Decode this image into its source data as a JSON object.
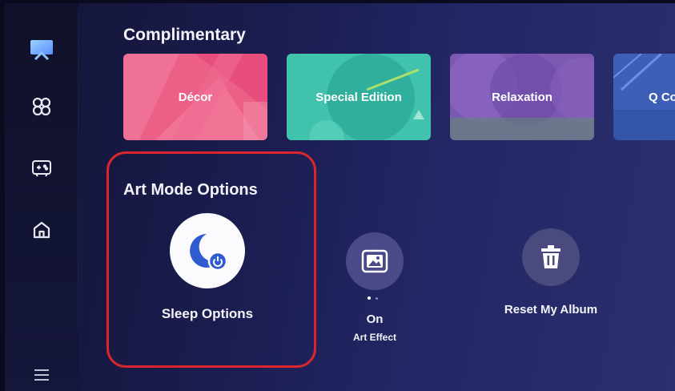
{
  "sidebar": {
    "items": [
      {
        "icon": "art-mode-icon",
        "active": true
      },
      {
        "icon": "ambient-icon"
      },
      {
        "icon": "game-controller-icon"
      },
      {
        "icon": "home-icon"
      }
    ],
    "menu_icon": "menu-icon"
  },
  "complimentary": {
    "title": "Complimentary",
    "tiles": [
      {
        "label": "Décor",
        "color": "#ec5f86"
      },
      {
        "label": "Special Edition",
        "color": "#41c2ad"
      },
      {
        "label": "Relaxation",
        "color": "#7b58b2"
      },
      {
        "label": "Q Co",
        "color": "#3d5fb8"
      }
    ]
  },
  "art_mode_options": {
    "title": "Art Mode Options",
    "sleep_options_label": "Sleep Options",
    "art_effect_value": "On",
    "art_effect_label": "Art Effect",
    "reset_label": "Reset My Album",
    "highlight_color": "#d9262d"
  }
}
